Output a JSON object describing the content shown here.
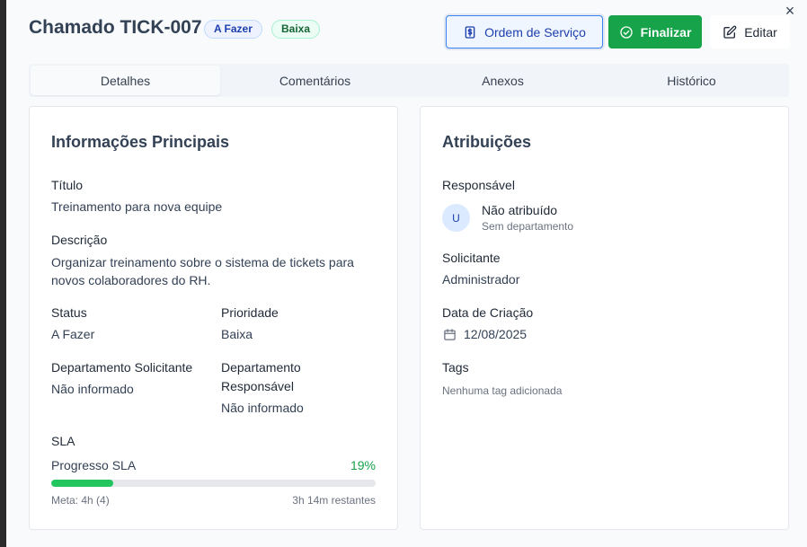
{
  "header": {
    "title": "Chamado TICK-007",
    "status_badge": "A Fazer",
    "priority_badge": "Baixa",
    "os_button": "Ordem de Serviço",
    "finalize_button": "Finalizar",
    "edit_button": "Editar",
    "close_glyph": "×"
  },
  "tabs": [
    {
      "label": "Detalhes",
      "active": true
    },
    {
      "label": "Comentários",
      "active": false
    },
    {
      "label": "Anexos",
      "active": false
    },
    {
      "label": "Histórico",
      "active": false
    }
  ],
  "main_info": {
    "heading": "Informações Principais",
    "title_label": "Título",
    "title_value": "Treinamento para nova equipe",
    "description_label": "Descrição",
    "description_value": "Organizar treinamento sobre o sistema de tickets para novos colaboradores do RH.",
    "status_label": "Status",
    "status_value": "A Fazer",
    "priority_label": "Prioridade",
    "priority_value": "Baixa",
    "requesting_dept_label": "Departamento Solicitante",
    "requesting_dept_value": "Não informado",
    "responsible_dept_label_1": "Departamento",
    "responsible_dept_label_2": "Responsável",
    "responsible_dept_value": "Não informado",
    "sla": {
      "label": "SLA",
      "progress_label": "Progresso SLA",
      "progress_percent_text": "19%",
      "progress_fraction": 0.19,
      "goal": "Meta: 4h (4)",
      "remaining": "3h 14m restantes"
    }
  },
  "assignments": {
    "heading": "Atribuições",
    "responsible_label": "Responsável",
    "avatar_initial": "U",
    "responsible_name": "Não atribuído",
    "responsible_dept": "Sem departamento",
    "requester_label": "Solicitante",
    "requester_value": "Administrador",
    "created_label": "Data de Criação",
    "created_value": "12/08/2025",
    "tags_label": "Tags",
    "tags_value": "Nenhuma tag adicionada"
  },
  "colors": {
    "accent_blue": "#3b82f6",
    "finalize_green": "#16a34a",
    "progress_green": "#22c55e"
  },
  "icons": [
    "close-icon",
    "dollar-document-icon",
    "check-circle-icon",
    "edit-icon",
    "calendar-icon"
  ]
}
